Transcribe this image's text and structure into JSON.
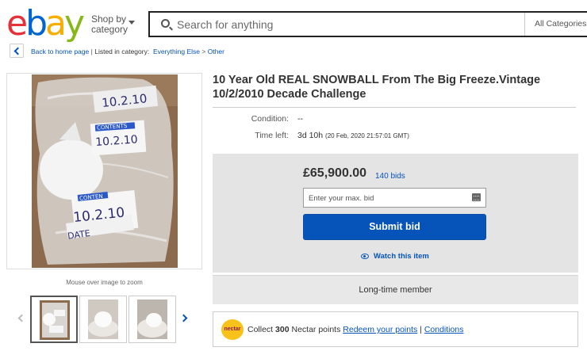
{
  "header": {
    "logo_letters": [
      "e",
      "b",
      "a",
      "y"
    ],
    "logo_colors": [
      "#e53238",
      "#0064d2",
      "#f5af02",
      "#86b817"
    ],
    "shop_by_line1": "Shop by",
    "shop_by_line2": "category",
    "search_placeholder": "Search for anything",
    "search_category": "All Categories"
  },
  "breadcrumb": {
    "back_label": "Back to home page",
    "separator": "|",
    "listed_label": "Listed in category:",
    "category_1": "Everything Else",
    "arrow": ">",
    "category_2": "Other"
  },
  "gallery": {
    "main_photo_labels": [
      "10.2.10",
      "CONTENTS",
      "10.2.10",
      "CONTEN",
      "10.2.10",
      "DATE"
    ],
    "zoom_note": "Mouse over image to zoom",
    "thumbnail_count": 3,
    "active_thumbnail": 1
  },
  "listing": {
    "title": "10 Year Old REAL SNOWBALL From The Big Freeze.Vintage 10/2/2010 Decade Challenge",
    "condition_label": "Condition:",
    "condition_value": "--",
    "time_left_label": "Time left:",
    "time_left_value": "3d 10h",
    "time_left_end": "(20 Feb, 2020  21:57:01 GMT)"
  },
  "bid": {
    "price": "£65,900.00",
    "bid_count": "140 bids",
    "input_placeholder": "Enter your max. bid",
    "submit_label": "Submit bid",
    "watch_label": "Watch this item",
    "member_text": "Long-time member"
  },
  "nectar": {
    "logo_text": "nectar",
    "collect_prefix": "Collect",
    "points": "300",
    "points_suffix": "Nectar points",
    "redeem_link": "Redeem your points",
    "separator": "|",
    "conditions_link": "Conditions"
  },
  "colors": {
    "link": "#0654ba",
    "button": "#0654ba",
    "bidbox_bg": "#e4e4e4"
  }
}
